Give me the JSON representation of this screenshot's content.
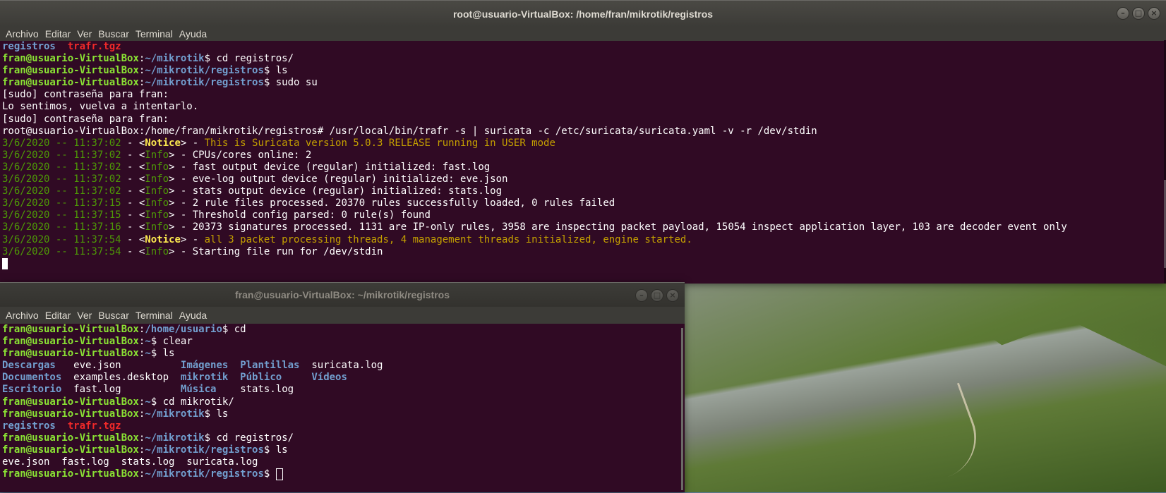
{
  "colors": {
    "terminal_bg": "#300a24",
    "user": "#8ae234",
    "path": "#729fcf",
    "archive": "#ef2929",
    "timestamp": "#4e9a06",
    "notice": "#fce94f"
  },
  "menu": [
    "Archivo",
    "Editar",
    "Ver",
    "Buscar",
    "Terminal",
    "Ayuda"
  ],
  "window_buttons": {
    "minimize": "–",
    "maximize": "□",
    "close": "×"
  },
  "win1": {
    "title": "root@usuario-VirtualBox: /home/fran/mikrotik/registros",
    "lines": [
      {
        "type": "ls2",
        "a": "registros",
        "a_sep": "  ",
        "b": "trafr.tgz"
      },
      {
        "type": "prompt",
        "user": "fran@usuario-VirtualBox",
        "path": "~/mikrotik",
        "cmd": "$ cd registros/"
      },
      {
        "type": "prompt",
        "user": "fran@usuario-VirtualBox",
        "path": "~/mikrotik/registros",
        "cmd": "$ ls"
      },
      {
        "type": "prompt",
        "user": "fran@usuario-VirtualBox",
        "path": "~/mikrotik/registros",
        "cmd": "$ sudo su"
      },
      {
        "type": "text",
        "text": "[sudo] contraseña para fran:"
      },
      {
        "type": "text",
        "text": "Lo sentimos, vuelva a intentarlo."
      },
      {
        "type": "text",
        "text": "[sudo] contraseña para fran:"
      },
      {
        "type": "text",
        "text": "root@usuario-VirtualBox:/home/fran/mikrotik/registros# /usr/local/bin/trafr -s | suricata -c /etc/suricata/suricata.yaml -v -r /dev/stdin"
      },
      {
        "type": "log",
        "ts": "3/6/2020 -- 11:37:02",
        "level": "Notice",
        "msg": "This is Suricata version 5.0.3 RELEASE running in USER mode"
      },
      {
        "type": "log",
        "ts": "3/6/2020 -- 11:37:02",
        "level": "Info",
        "msg": "CPUs/cores online: 2"
      },
      {
        "type": "log",
        "ts": "3/6/2020 -- 11:37:02",
        "level": "Info",
        "msg": "fast output device (regular) initialized: fast.log"
      },
      {
        "type": "log",
        "ts": "3/6/2020 -- 11:37:02",
        "level": "Info",
        "msg": "eve-log output device (regular) initialized: eve.json"
      },
      {
        "type": "log",
        "ts": "3/6/2020 -- 11:37:02",
        "level": "Info",
        "msg": "stats output device (regular) initialized: stats.log"
      },
      {
        "type": "log",
        "ts": "3/6/2020 -- 11:37:15",
        "level": "Info",
        "msg": "2 rule files processed. 20370 rules successfully loaded, 0 rules failed"
      },
      {
        "type": "log",
        "ts": "3/6/2020 -- 11:37:15",
        "level": "Info",
        "msg": "Threshold config parsed: 0 rule(s) found"
      },
      {
        "type": "log",
        "ts": "3/6/2020 -- 11:37:16",
        "level": "Info",
        "msg": "20373 signatures processed. 1131 are IP-only rules, 3958 are inspecting packet payload, 15054 inspect application layer, 103 are decoder event only"
      },
      {
        "type": "log",
        "ts": "3/6/2020 -- 11:37:54",
        "level": "Notice",
        "msg": "all 3 packet processing threads, 4 management threads initialized, engine started."
      },
      {
        "type": "log",
        "ts": "3/6/2020 -- 11:37:54",
        "level": "Info",
        "msg": "Starting file run for /dev/stdin"
      }
    ]
  },
  "win2": {
    "title": "fran@usuario-VirtualBox: ~/mikrotik/registros",
    "lines": [
      {
        "type": "prompt",
        "user": "fran@usuario-VirtualBox",
        "path": "/home/usuario",
        "cmd": "$ cd"
      },
      {
        "type": "prompt",
        "user": "fran@usuario-VirtualBox",
        "path": "~",
        "cmd": "$ clear"
      },
      {
        "type": "prompt",
        "user": "fran@usuario-VirtualBox",
        "path": "~",
        "cmd": "$ ls"
      },
      {
        "type": "cols",
        "cells": [
          {
            "t": "Descargas",
            "c": "dir"
          },
          {
            "t": "eve.json",
            "c": ""
          },
          {
            "t": "Imágenes",
            "c": "dir"
          },
          {
            "t": "Plantillas",
            "c": "dir"
          },
          {
            "t": "suricata.log",
            "c": ""
          }
        ]
      },
      {
        "type": "cols",
        "cells": [
          {
            "t": "Documentos",
            "c": "dir"
          },
          {
            "t": "examples.desktop",
            "c": ""
          },
          {
            "t": "mikrotik",
            "c": "dir"
          },
          {
            "t": "Público",
            "c": "dir"
          },
          {
            "t": "Vídeos",
            "c": "dir"
          }
        ]
      },
      {
        "type": "cols",
        "cells": [
          {
            "t": "Escritorio",
            "c": "dir"
          },
          {
            "t": "fast.log",
            "c": ""
          },
          {
            "t": "Música",
            "c": "dir"
          },
          {
            "t": "stats.log",
            "c": ""
          },
          {
            "t": "",
            "c": ""
          }
        ]
      },
      {
        "type": "prompt",
        "user": "fran@usuario-VirtualBox",
        "path": "~",
        "cmd": "$ cd mikrotik/"
      },
      {
        "type": "prompt",
        "user": "fran@usuario-VirtualBox",
        "path": "~/mikrotik",
        "cmd": "$ ls"
      },
      {
        "type": "ls2",
        "a": "registros",
        "a_sep": "  ",
        "b": "trafr.tgz"
      },
      {
        "type": "prompt",
        "user": "fran@usuario-VirtualBox",
        "path": "~/mikrotik",
        "cmd": "$ cd registros/"
      },
      {
        "type": "prompt",
        "user": "fran@usuario-VirtualBox",
        "path": "~/mikrotik/registros",
        "cmd": "$ ls"
      },
      {
        "type": "text",
        "text": "eve.json  fast.log  stats.log  suricata.log"
      },
      {
        "type": "prompt",
        "user": "fran@usuario-VirtualBox",
        "path": "~/mikrotik/registros",
        "cmd": "$ "
      }
    ]
  }
}
